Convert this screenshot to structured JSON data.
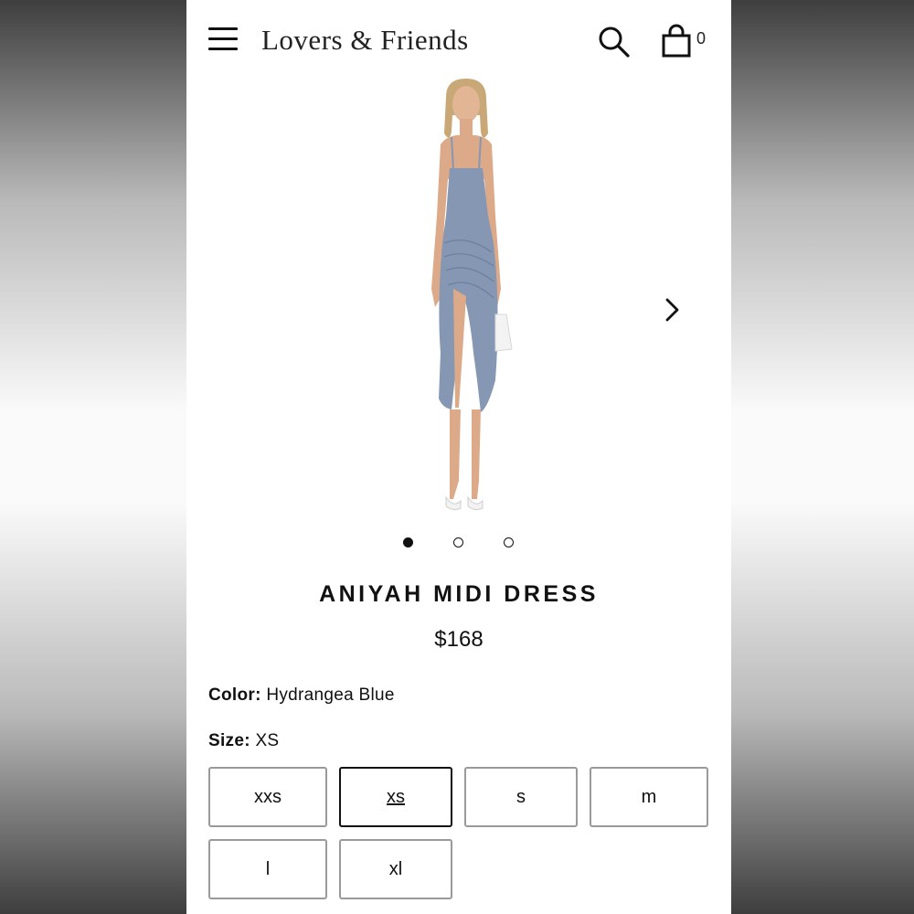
{
  "header": {
    "brand": "Lovers & Friends",
    "cart_count": "0"
  },
  "gallery": {
    "image_count": 3,
    "active_index": 0
  },
  "product": {
    "title": "ANIYAH MIDI DRESS",
    "price": "$168",
    "color_label": "Color:",
    "color_value": "Hydrangea Blue",
    "size_label": "Size:",
    "size_value": "XS",
    "sizes": [
      "xxs",
      "xs",
      "s",
      "m",
      "l",
      "xl"
    ],
    "selected_size": "xs"
  },
  "colors": {
    "dress": "#8597b3",
    "accent": "#111111",
    "border": "#9a9a9a"
  }
}
